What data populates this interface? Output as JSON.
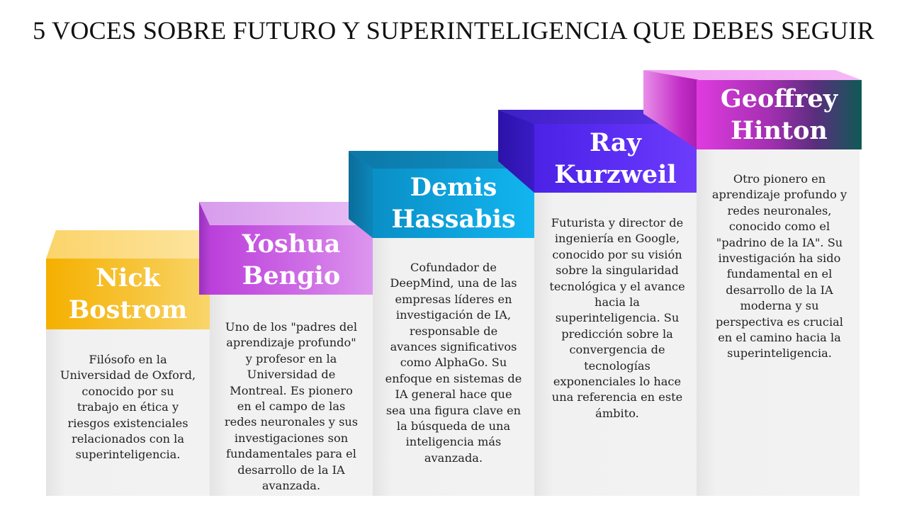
{
  "title": "5 VOCES SOBRE FUTURO Y SUPERINTELIGENCIA QUE DEBES SEGUIR",
  "people": [
    {
      "name_line1": "Nick",
      "name_line2": "Bostrom",
      "description": "Filósofo en la Universidad de Oxford, conocido por su trabajo en ética y riesgos existenciales relacionados con la superinteligencia.",
      "color": "#f5b51e"
    },
    {
      "name_line1": "Yoshua",
      "name_line2": "Bengio",
      "description": "Uno de los \"padres del aprendizaje profundo\" y profesor en la Universidad de Montreal. Es pionero en el campo de las redes neuronales y sus investigaciones son fundamentales para el desarrollo de la IA avanzada.",
      "color": "#c04ee0"
    },
    {
      "name_line1": "Demis",
      "name_line2": "Hassabis",
      "description": "Cofundador de DeepMind, una de las empresas líderes en investigación de IA, responsable de avances significativos como AlphaGo. Su enfoque en sistemas de IA general hace que sea una figura clave en la búsqueda de una inteligencia más avanzada.",
      "color": "#0a9ad8"
    },
    {
      "name_line1": "Ray",
      "name_line2": "Kurzweil",
      "description": "Futurista y director de ingeniería en Google, conocido por su visión sobre la singularidad tecnológica y el avance hacia la superinteligencia. Su predicción sobre la convergencia de tecnologías exponenciales lo hace una referencia en este ámbito.",
      "color": "#5b26f0"
    },
    {
      "name_line1": "Geoffrey",
      "name_line2": "Hinton",
      "description": "Otro pionero en aprendizaje profundo y redes neuronales, conocido como el \"padrino de la IA\". Su investigación ha sido fundamental en el desarrollo de la IA moderna y su perspectiva es crucial en el camino hacia la superinteligencia.",
      "color": "#d630d8"
    }
  ]
}
